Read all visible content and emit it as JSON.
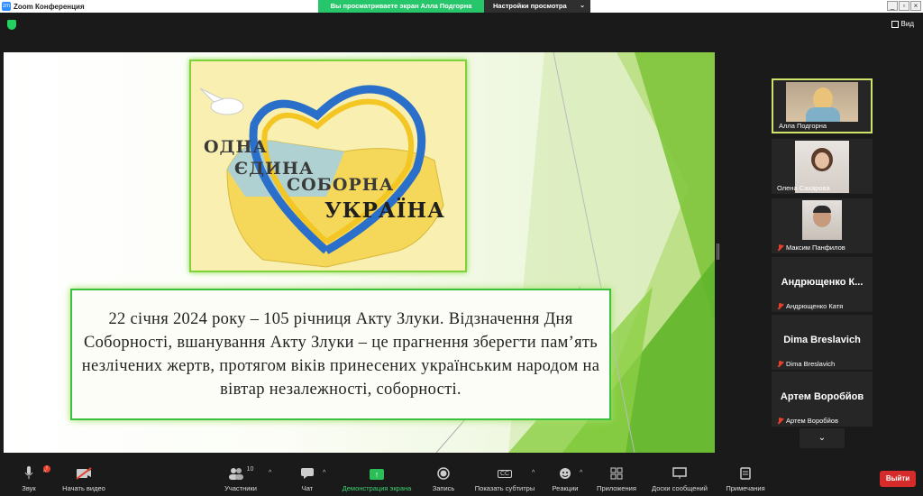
{
  "app": {
    "title": "Zoom Конференция",
    "icon_text": "zm"
  },
  "share_banner": {
    "status": "Вы просматриваете экран Алла Подгорна",
    "view_options": "Настройки просмотра"
  },
  "topbar": {
    "view_label": "Вид"
  },
  "slide": {
    "poster_lines": [
      "ОДНА",
      "ЄДИНА",
      "СОБОРНА",
      "УКРАЇНА"
    ],
    "text": "22 січня 2024 року – 105 річниця Акту Злуки. Відзначення Дня Соборності, вшанування Акту Злуки – це прагнення зберегти пам’ять незлічених жертв, протягом віків принесених українським народом на вівтар незалежності, соборності."
  },
  "participants": [
    {
      "name": "Алла Подгорна",
      "video": true,
      "active": true,
      "muted": false
    },
    {
      "name": "Олена Сахарова",
      "video": true,
      "active": false,
      "muted": false
    },
    {
      "name": "Максим Панфилов",
      "video": true,
      "active": false,
      "muted": true
    },
    {
      "name": "Андрющенко Катя",
      "display": "Андрющенко  К...",
      "video": false,
      "active": false,
      "muted": true
    },
    {
      "name": "Dima Breslavich",
      "display": "Dima Breslavich",
      "video": false,
      "active": false,
      "muted": true
    },
    {
      "name": "Артем Воробйов",
      "display": "Артем Воробйов",
      "video": false,
      "active": false,
      "muted": true
    }
  ],
  "toolbar": {
    "audio": "Звук",
    "audio_badge": "!",
    "video": "Начать видео",
    "participants": "Участники",
    "participants_count": "10",
    "chat": "Чат",
    "share": "Демонстрация экрана",
    "record": "Запись",
    "captions": "Показать субтитры",
    "captions_icon": "CC",
    "reactions": "Реакции",
    "apps": "Приложения",
    "whiteboards": "Доски сообщений",
    "notes": "Примечания",
    "leave": "Выйти"
  },
  "colors": {
    "share_green": "#27c66a",
    "active_border": "#cfe56a",
    "leave_red": "#d62b2b",
    "slide_green": "#7fd13b"
  }
}
